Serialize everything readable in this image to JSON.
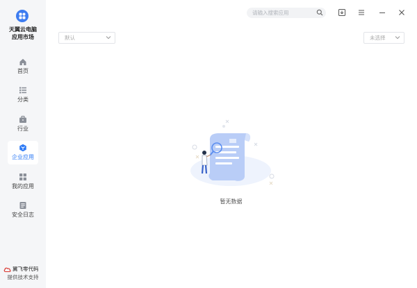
{
  "app": {
    "title_line1": "天翼云电脑",
    "title_line2": "应用市场"
  },
  "sidebar": {
    "items": [
      {
        "label": "首页",
        "icon": "home-icon"
      },
      {
        "label": "分类",
        "icon": "category-icon"
      },
      {
        "label": "行业",
        "icon": "briefcase-icon"
      },
      {
        "label": "企业应用",
        "icon": "enterprise-cube-icon",
        "active": true
      },
      {
        "label": "我的应用",
        "icon": "grid-icon"
      },
      {
        "label": "安全日志",
        "icon": "log-icon"
      }
    ],
    "brand_name": "翼飞零代码",
    "brand_tag": "提供技术支持"
  },
  "header": {
    "search_placeholder": "请输入搜索应用",
    "icons": [
      "search-icon",
      "download-icon",
      "menu-icon",
      "minimize-icon",
      "close-icon"
    ]
  },
  "filters": {
    "left_select": "默认",
    "right_select": "未选择"
  },
  "empty": {
    "text": "暂无数据"
  },
  "colors": {
    "accent": "#2f7bf5",
    "sidebar_bg": "#f5f6f8",
    "illustration": "#b9cdf7"
  }
}
